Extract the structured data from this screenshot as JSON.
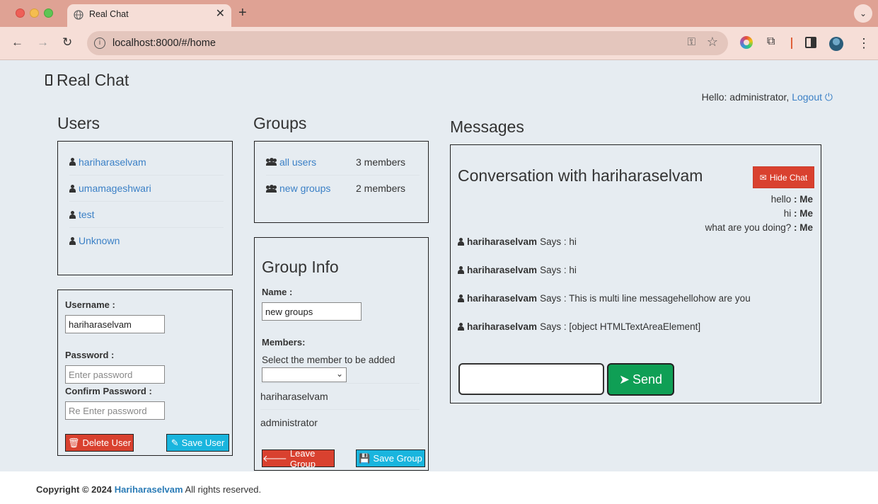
{
  "browser": {
    "tab_title": "Real Chat",
    "tab_close": "✕",
    "new_tab": "+",
    "url": "localhost:8000/#/home"
  },
  "app": {
    "brand": "Real Chat",
    "hello_text": "Hello: administrator,",
    "logout_label": "Logout"
  },
  "users": {
    "title": "Users",
    "items": [
      {
        "name": "hariharaselvam"
      },
      {
        "name": "umamageshwari"
      },
      {
        "name": "test"
      },
      {
        "name": "Unknown"
      }
    ]
  },
  "user_form": {
    "username_label": "Username :",
    "username_value": "hariharaselvam",
    "password_label": "Password :",
    "password_placeholder": "Enter password",
    "confirm_label": "Confirm Password :",
    "confirm_placeholder": "Re Enter password",
    "delete_label": "Delete User",
    "save_label": "Save User"
  },
  "groups": {
    "title": "Groups",
    "items": [
      {
        "name": "all users",
        "members": "3 members"
      },
      {
        "name": "new groups",
        "members": "2 members"
      }
    ]
  },
  "group_info": {
    "title": "Group Info",
    "name_label": "Name :",
    "name_value": "new groups",
    "members_label": "Members:",
    "select_label": "Select the member to be added",
    "select_value": "",
    "members": [
      "hariharaselvam",
      "administrator"
    ],
    "leave_label": "Leave Group",
    "save_label": "Save Group"
  },
  "messages": {
    "title": "Messages",
    "conversation_title": "Conversation with hariharaselvam",
    "hide_chat_label": "Hide Chat",
    "sent": [
      {
        "text": "hello",
        "suffix": ": Me"
      },
      {
        "text": "hi",
        "suffix": ": Me"
      },
      {
        "text": "what are you doing?",
        "suffix": ": Me"
      }
    ],
    "received": [
      {
        "sender": "hariharaselvam",
        "text": "Says : hi"
      },
      {
        "sender": "hariharaselvam",
        "text": "Says : hi"
      },
      {
        "sender": "hariharaselvam",
        "text": "Says : This is multi line messagehellohow are you"
      },
      {
        "sender": "hariharaselvam",
        "text": "Says : [object HTMLTextAreaElement]"
      }
    ],
    "input_value": "",
    "send_label": "Send"
  },
  "footer": {
    "copyright": "Copyright © 2024",
    "author": "Hariharaselvam",
    "rights": "All rights reserved."
  }
}
